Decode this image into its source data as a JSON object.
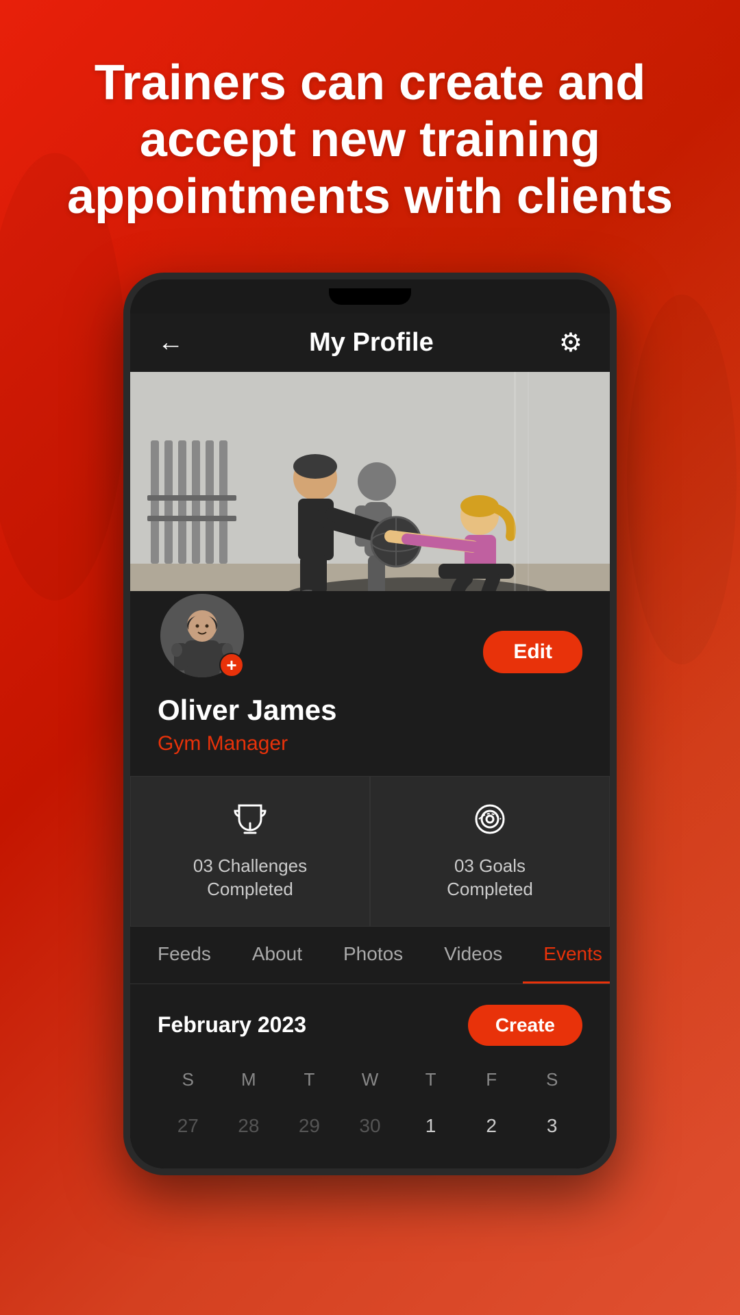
{
  "hero": {
    "headline_line1": "Trainers can create and",
    "headline_line2": "accept new training",
    "headline_line3": "appointments with clients"
  },
  "nav": {
    "title": "My Profile",
    "back_icon": "←",
    "settings_icon": "⚙"
  },
  "profile": {
    "name": "Oliver James",
    "role": "Gym Manager",
    "edit_label": "Edit"
  },
  "stats": [
    {
      "number": "03",
      "label": "Challenges\nCompleted",
      "icon": "trophy"
    },
    {
      "number": "03",
      "label": "Goals\nCompleted",
      "icon": "target"
    }
  ],
  "tabs": [
    {
      "label": "Feeds",
      "active": false
    },
    {
      "label": "About",
      "active": false
    },
    {
      "label": "Photos",
      "active": false
    },
    {
      "label": "Videos",
      "active": false
    },
    {
      "label": "Events",
      "active": true
    }
  ],
  "calendar": {
    "month": "February 2023",
    "create_label": "Create",
    "day_headers": [
      "S",
      "M",
      "T",
      "W",
      "T",
      "F",
      "S"
    ],
    "dates_prev": [
      "27",
      "28",
      "29",
      "30"
    ],
    "dates_curr": [
      "1",
      "2",
      "3"
    ]
  },
  "colors": {
    "accent": "#e8320a",
    "bg_dark": "#121212",
    "bg_card": "#2a2a2a",
    "text_primary": "#ffffff",
    "text_secondary": "#aaaaaa",
    "text_dim": "#555555"
  }
}
